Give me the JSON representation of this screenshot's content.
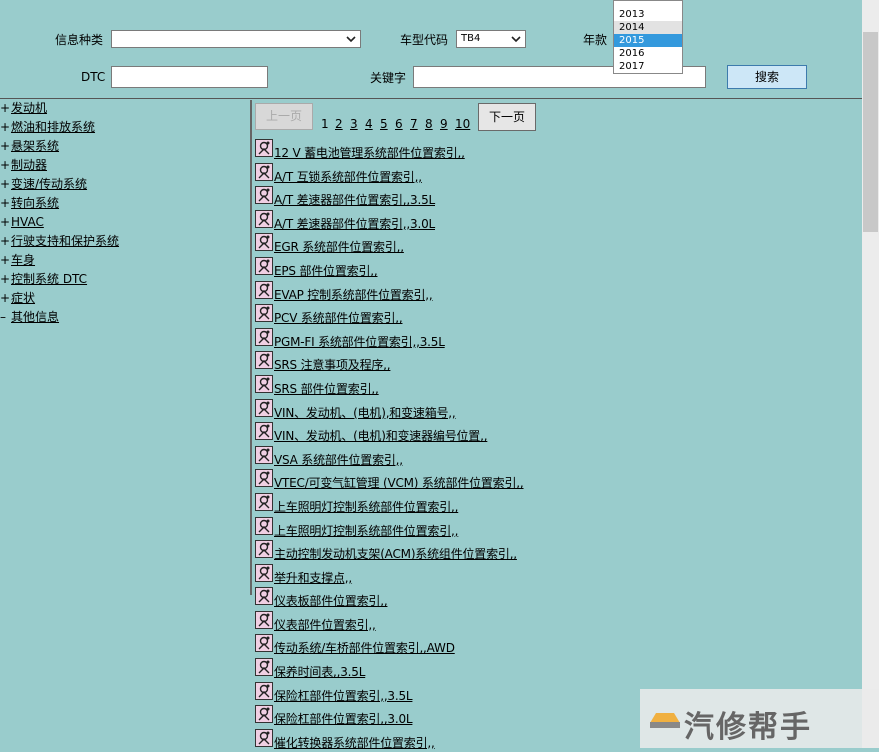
{
  "filters": {
    "info_type_label": "信息种类",
    "info_type_value": "",
    "model_code_label": "车型代码",
    "model_code_value": "TB4",
    "year_label": "年款",
    "dtc_label": "DTC",
    "dtc_value": "",
    "keyword_label": "关键字",
    "keyword_value": "",
    "search_label": "搜索"
  },
  "year_dropdown": {
    "options": [
      "2013",
      "2014",
      "2015",
      "2016",
      "2017"
    ],
    "selected": "2015",
    "hovered": "2014"
  },
  "tree": [
    {
      "mark": "+",
      "label": "发动机"
    },
    {
      "mark": "+",
      "label": "燃油和排放系统"
    },
    {
      "mark": "+",
      "label": "悬架系统"
    },
    {
      "mark": "+",
      "label": "制动器"
    },
    {
      "mark": "+",
      "label": "变速/传动系统"
    },
    {
      "mark": "+",
      "label": "转向系统"
    },
    {
      "mark": "+",
      "label": "HVAC"
    },
    {
      "mark": "+",
      "label": "行驶支持和保护系统"
    },
    {
      "mark": "+",
      "label": "车身"
    },
    {
      "mark": "+",
      "label": "控制系统 DTC"
    },
    {
      "mark": "+",
      "label": "症状"
    },
    {
      "mark": "–",
      "label": "其他信息"
    }
  ],
  "pager": {
    "prev_label": "上一页",
    "next_label": "下一页",
    "pages": [
      "1",
      "2",
      "3",
      "4",
      "5",
      "6",
      "7",
      "8",
      "9",
      "10"
    ],
    "current": "1"
  },
  "documents": [
    "12 V 蓄电池管理系统部件位置索引,,",
    "A/T 互锁系统部件位置索引,,",
    "A/T 差速器部件位置索引,,3.5L",
    "A/T 差速器部件位置索引,,3.0L",
    "EGR 系统部件位置索引,,",
    "EPS 部件位置索引,,",
    "EVAP 控制系统部件位置索引,,",
    "PCV 系统部件位置索引,,",
    "PGM-FI 系统部件位置索引,,3.5L",
    "SRS 注意事项及程序,,",
    "SRS 部件位置索引,,",
    "VIN、发动机、(电机),和变速箱号,,",
    "VIN、发动机、(电机)和变速器编号位置,,",
    "VSA 系统部件位置索引,,",
    "VTEC/可变气缸管理 (VCM) 系统部件位置索引,,",
    "上车照明灯控制系统部件位置索引,,",
    "上车照明灯控制系统部件位置索引,,",
    "主动控制发动机支架(ACM)系统组件位置索引,,",
    "举升和支撑点,,",
    "仪表板部件位置索引,,",
    "仪表部件位置索引,,",
    "传动系统/车桥部件位置索引,,AWD",
    "保养时间表,,3.5L",
    "保险杠部件位置索引,,3.5L",
    "保险杠部件位置索引,,3.0L",
    "催化转换器系统部件位置索引,,"
  ],
  "watermark": "汽修帮手"
}
